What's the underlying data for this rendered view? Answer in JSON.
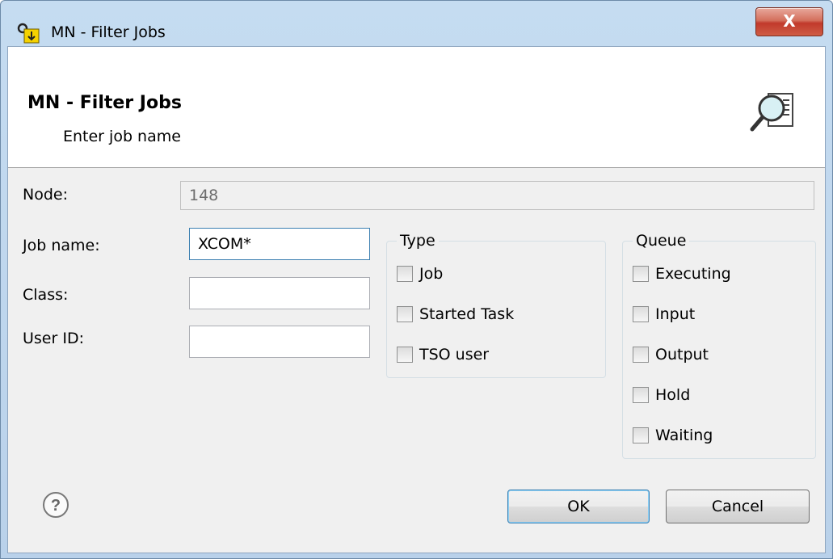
{
  "window": {
    "title": "MN - Filter Jobs",
    "close_label": "X"
  },
  "header": {
    "title": "MN - Filter Jobs",
    "subtitle": "Enter job name"
  },
  "form": {
    "node": {
      "label": "Node:",
      "value": "148"
    },
    "job_name": {
      "label": "Job name:",
      "value": "XCOM*"
    },
    "class": {
      "label": "Class:",
      "value": ""
    },
    "user_id": {
      "label": "User ID:",
      "value": ""
    }
  },
  "type_group": {
    "title": "Type",
    "options": [
      {
        "label": "Job",
        "checked": false
      },
      {
        "label": "Started Task",
        "checked": false
      },
      {
        "label": "TSO user",
        "checked": false
      }
    ]
  },
  "queue_group": {
    "title": "Queue",
    "options": [
      {
        "label": "Executing",
        "checked": false
      },
      {
        "label": "Input",
        "checked": false
      },
      {
        "label": "Output",
        "checked": false
      },
      {
        "label": "Hold",
        "checked": false
      },
      {
        "label": "Waiting",
        "checked": false
      }
    ]
  },
  "buttons": {
    "ok": "OK",
    "cancel": "Cancel"
  },
  "icons": {
    "app": "filter-app-icon",
    "wizard": "magnifier-document-icon",
    "help": "help-icon"
  },
  "colors": {
    "titlebar": "#b9d1ea",
    "close": "#c1392b",
    "dialog_bg": "#f0f0f0",
    "default_button_border": "#3c7fb1"
  }
}
